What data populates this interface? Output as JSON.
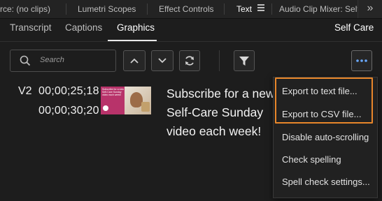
{
  "panel_tabs": {
    "source": "rce: (no clips)",
    "lumetri": "Lumetri Scopes",
    "effect_controls": "Effect Controls",
    "text": "Text",
    "audio_mixer": "Audio Clip Mixer: Self"
  },
  "sub_tabs": {
    "transcript": "Transcript",
    "captions": "Captions",
    "graphics": "Graphics",
    "sequence_name": "Self Care"
  },
  "search": {
    "placeholder": "Search"
  },
  "graphic_item": {
    "track": "V2",
    "in_time": "00;00;25;18",
    "out_time": "00;00;30;20",
    "thumbnail_text": "Subscribe for a new Self-Care Sunday video each week!",
    "caption_lines": [
      "Subscribe for a new",
      "Self-Care Sunday",
      "video each week!"
    ]
  },
  "menu": {
    "items": [
      "Export to text file...",
      "Export to CSV file...",
      "Disable auto-scrolling",
      "Check spelling",
      "Spell check settings..."
    ]
  },
  "colors": {
    "background": "#1d1d1d",
    "highlight": "#e8862a",
    "accent_blue": "#6aa9ff"
  }
}
